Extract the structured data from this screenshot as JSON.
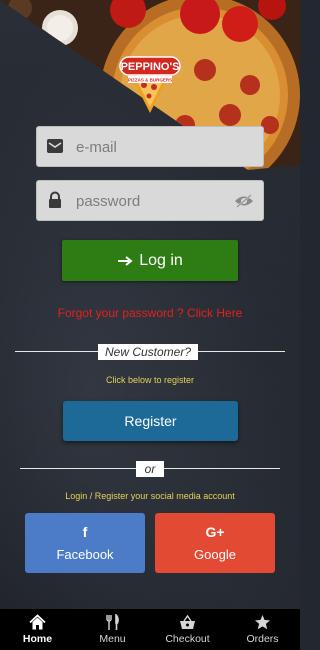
{
  "brand": {
    "name": "PEPPINO'S",
    "tagline": "PIZZAS & BURGERS"
  },
  "login_form": {
    "email_placeholder": "e-mail",
    "password_placeholder": "password",
    "login_label": "Log in",
    "forgot_text": "Forgot your password ? Click Here"
  },
  "register": {
    "divider_label": "New Customer?",
    "note": "Click below to register",
    "button_label": "Register"
  },
  "social": {
    "divider_label": "or",
    "note": "Login / Register your social media account",
    "facebook_label": "Facebook",
    "facebook_icon": "f",
    "google_label": "Google",
    "google_icon": "G+"
  },
  "tabbar": {
    "items": [
      {
        "label": "Home",
        "icon": "home-icon",
        "active": true
      },
      {
        "label": "Menu",
        "icon": "fork-knife-icon",
        "active": false
      },
      {
        "label": "Checkout",
        "icon": "basket-icon",
        "active": false
      },
      {
        "label": "Orders",
        "icon": "star-icon",
        "active": false
      }
    ]
  },
  "colors": {
    "login_button": "#2e7d14",
    "register_button": "#1d6a99",
    "facebook": "#4c7bc8",
    "google": "#e24a34",
    "forgot_text": "#e5201e",
    "note_text": "#e3d25a"
  }
}
